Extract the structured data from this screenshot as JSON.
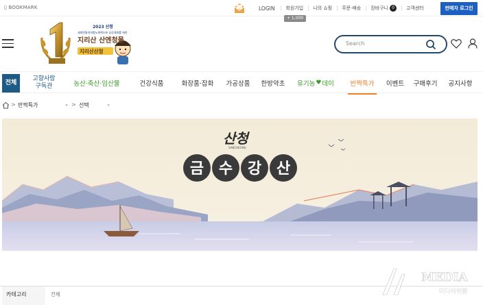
{
  "topbar": {
    "bookmark": "▯ BOOKMARK",
    "links": [
      {
        "label": "LOGIN"
      },
      {
        "label": "회원가입"
      },
      {
        "label": "나의 쇼핑"
      },
      {
        "label": "주문·배송"
      },
      {
        "label": "장바구니",
        "count": "0"
      },
      {
        "label": "고객센터"
      }
    ],
    "seller_login": "판매자 로그인",
    "points_badge": "+ 1,000"
  },
  "header": {
    "logo": {
      "year_line": "2023 산청",
      "small_line": "세계전통의약항노화엑스포 성공개최를 위한",
      "big_line": "지리산 산엔청몰",
      "sub_line": "지리산산청"
    },
    "search": {
      "placeholder": "Search"
    }
  },
  "catnav": {
    "all": "전체",
    "items": [
      {
        "label": "고향사랑",
        "label2": "구독관"
      },
      {
        "label": "농산·축산·임산물"
      },
      {
        "label": "건강식품"
      },
      {
        "label": "화장품·잡화"
      },
      {
        "label": "가공상품"
      },
      {
        "label": "한방약초"
      },
      {
        "label_a": "유기농",
        "label_b": "데이"
      },
      {
        "label": "반짝특가"
      },
      {
        "label": "이벤트"
      },
      {
        "label": "구매후기"
      },
      {
        "label": "공지사항"
      }
    ]
  },
  "breadcrumb": {
    "separator": ">",
    "first_select": "반짝특가",
    "second_select": "선택"
  },
  "banner": {
    "calligraphy": "산청",
    "calligraphy_sub": "SANCHEONG",
    "title_chars": [
      "금",
      "수",
      "강",
      "산"
    ]
  },
  "filter": {
    "label": "카테고리",
    "value": "전체"
  },
  "watermark": {
    "brand": "MEDIA",
    "sub": "미디어위원"
  },
  "colors": {
    "seller_button": "#1e5fc2",
    "all_tab": "#1d5a85",
    "green": "#3a9c27",
    "active_tab": "#e8822c",
    "search_border": "#24486b"
  }
}
